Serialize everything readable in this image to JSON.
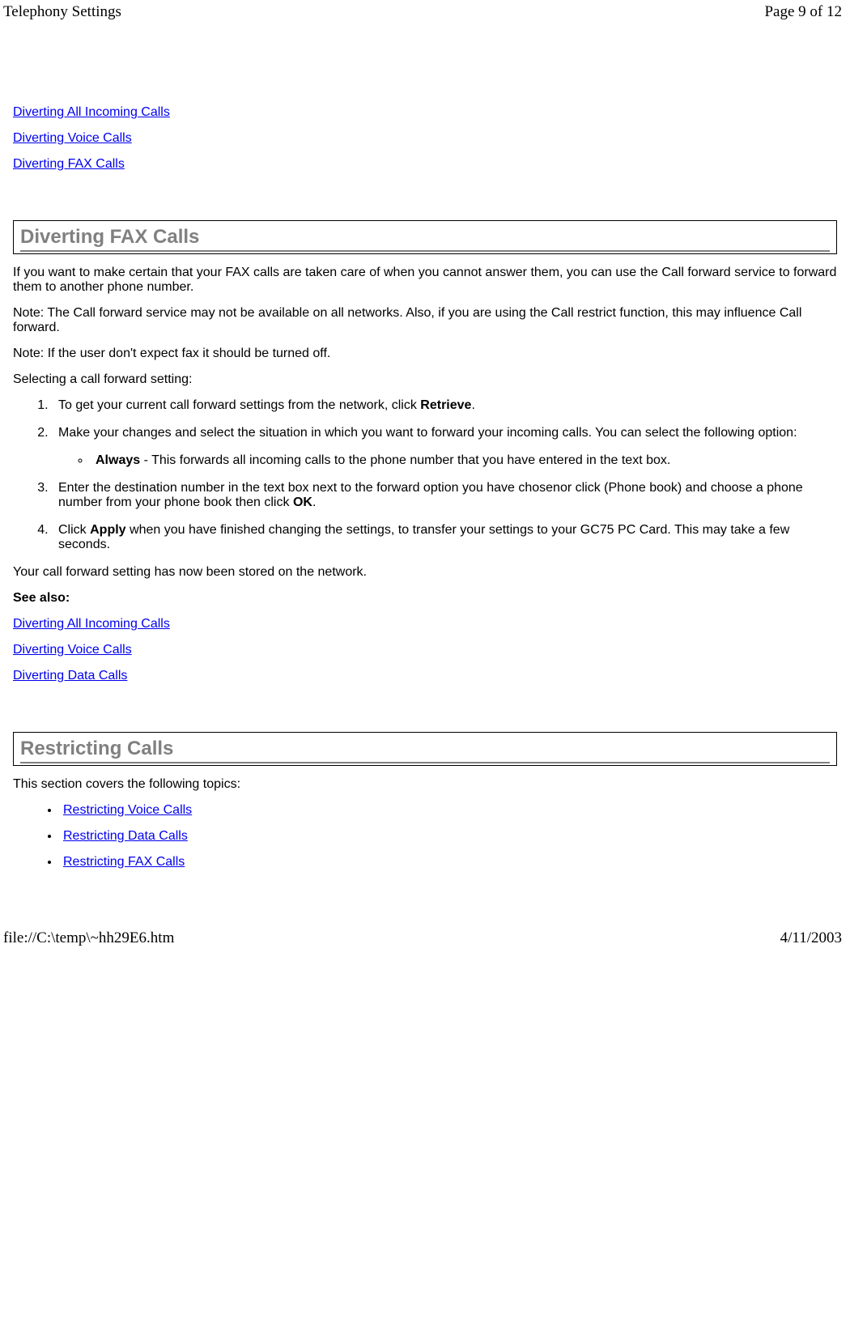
{
  "header": {
    "title": "Telephony Settings",
    "page_indicator": "Page 9 of 12"
  },
  "see_also_top": {
    "links": [
      "Diverting All Incoming Calls",
      "Diverting Voice Calls",
      "Diverting FAX Calls"
    ]
  },
  "section_fax": {
    "heading": "Diverting FAX Calls",
    "intro": "If you want to make certain that your FAX calls are taken care of when you cannot answer them, you can use the Call forward service to forward them to another phone number.",
    "note1": "Note: The Call forward service may not be available on all networks. Also, if you are using the Call restrict function, this may influence Call forward.",
    "note2": "Note: If the user don't expect fax it should be turned off.",
    "selecting_label": "Selecting a call forward setting:",
    "steps": {
      "s1_a": "To get your current call forward settings from the network, click ",
      "s1_b": "Retrieve",
      "s1_c": ".",
      "s2": "Make your changes and select the situation in which you want to forward your incoming calls. You can select the following option:",
      "s2_sub_a": "Always",
      "s2_sub_b": " - This forwards all incoming calls to the phone number that you have entered in the text box.",
      "s3_a": "Enter the destination number in the text box next to the forward option you have chosenor click (Phone book) and choose a phone number from your phone book then click ",
      "s3_b": "OK",
      "s3_c": ".",
      "s4_a": "Click ",
      "s4_b": "Apply",
      "s4_c": " when you have finished changing the settings, to transfer your settings to your GC75 PC Card. This may take a few seconds."
    },
    "stored_msg": "Your call forward setting has now been stored on the network.",
    "see_also_label": "See also:",
    "see_also_links": [
      "Diverting All Incoming Calls",
      "Diverting Voice Calls",
      "Diverting Data Calls"
    ]
  },
  "section_restrict": {
    "heading": "Restricting Calls",
    "intro": "This section covers the following topics:",
    "links": [
      "Restricting Voice Calls",
      "Restricting Data Calls",
      "Restricting FAX Calls"
    ]
  },
  "footer": {
    "path": "file://C:\\temp\\~hh29E6.htm",
    "date": "4/11/2003"
  }
}
